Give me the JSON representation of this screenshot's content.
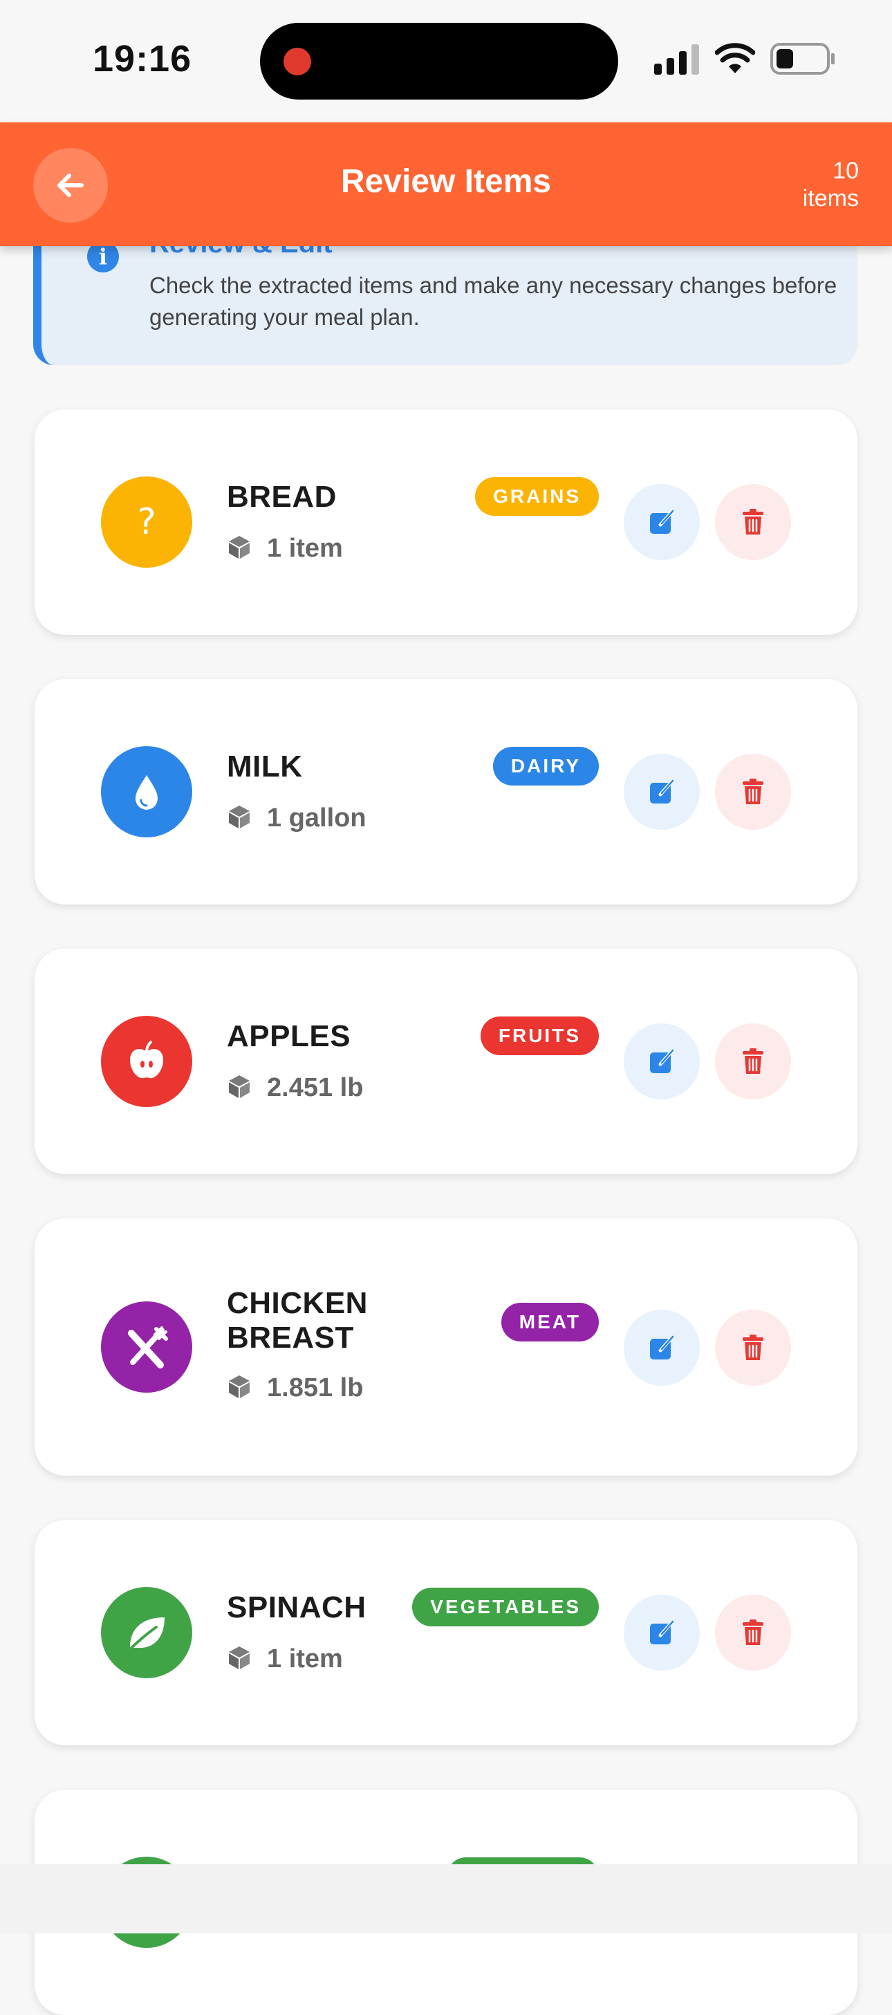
{
  "status_bar": {
    "time": "19:16"
  },
  "header": {
    "title": "Review Items",
    "count_number": "10",
    "count_unit": "items"
  },
  "info": {
    "title": "Review & Edit",
    "text": "Check the extracted items and make any necessary changes before generating your meal plan."
  },
  "items": [
    {
      "name": "BREAD",
      "quantity": "1 item",
      "category": "GRAINS",
      "color": "#fbb404",
      "icon": "question-icon"
    },
    {
      "name": "MILK",
      "quantity": "1 gallon",
      "category": "DAIRY",
      "color": "#2b86e8",
      "icon": "water-drop-icon"
    },
    {
      "name": "APPLES",
      "quantity": "2.451 lb",
      "category": "FRUITS",
      "color": "#ea3530",
      "icon": "apple-icon"
    },
    {
      "name": "CHICKEN BREAST",
      "quantity": "1.851 lb",
      "category": "MEAT",
      "color": "#9423a8",
      "icon": "utensils-icon"
    },
    {
      "name": "SPINACH",
      "quantity": "1 item",
      "category": "VEGETABLES",
      "color": "#40a447",
      "icon": "leaf-icon"
    },
    {
      "name": "",
      "quantity": "",
      "category": "",
      "color": "#40a447",
      "icon": "leaf-icon"
    }
  ]
}
